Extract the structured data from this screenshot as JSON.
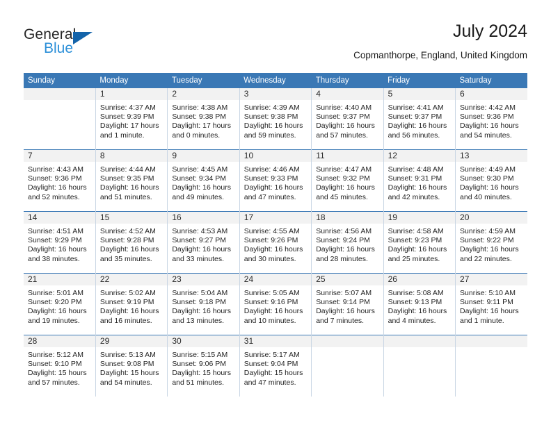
{
  "brand": {
    "name_top": "General",
    "name_bottom": "Blue",
    "triangle_color": "#1464aa",
    "blue_color": "#2b8fd8"
  },
  "header": {
    "title": "July 2024",
    "subtitle": "Copmanthorpe, England, United Kingdom"
  },
  "theme": {
    "header_bg": "#3a78b5",
    "daynum_bg": "#f2f2f2",
    "grid_line": "#c9d6e4",
    "week_line": "#3a78b5"
  },
  "weekday_headers": [
    "Sunday",
    "Monday",
    "Tuesday",
    "Wednesday",
    "Thursday",
    "Friday",
    "Saturday"
  ],
  "weeks": [
    [
      {
        "day": "",
        "sunrise": "",
        "sunset": "",
        "daylight_1": "",
        "daylight_2": ""
      },
      {
        "day": "1",
        "sunrise": "Sunrise: 4:37 AM",
        "sunset": "Sunset: 9:39 PM",
        "daylight_1": "Daylight: 17 hours",
        "daylight_2": "and 1 minute."
      },
      {
        "day": "2",
        "sunrise": "Sunrise: 4:38 AM",
        "sunset": "Sunset: 9:38 PM",
        "daylight_1": "Daylight: 17 hours",
        "daylight_2": "and 0 minutes."
      },
      {
        "day": "3",
        "sunrise": "Sunrise: 4:39 AM",
        "sunset": "Sunset: 9:38 PM",
        "daylight_1": "Daylight: 16 hours",
        "daylight_2": "and 59 minutes."
      },
      {
        "day": "4",
        "sunrise": "Sunrise: 4:40 AM",
        "sunset": "Sunset: 9:37 PM",
        "daylight_1": "Daylight: 16 hours",
        "daylight_2": "and 57 minutes."
      },
      {
        "day": "5",
        "sunrise": "Sunrise: 4:41 AM",
        "sunset": "Sunset: 9:37 PM",
        "daylight_1": "Daylight: 16 hours",
        "daylight_2": "and 56 minutes."
      },
      {
        "day": "6",
        "sunrise": "Sunrise: 4:42 AM",
        "sunset": "Sunset: 9:36 PM",
        "daylight_1": "Daylight: 16 hours",
        "daylight_2": "and 54 minutes."
      }
    ],
    [
      {
        "day": "7",
        "sunrise": "Sunrise: 4:43 AM",
        "sunset": "Sunset: 9:36 PM",
        "daylight_1": "Daylight: 16 hours",
        "daylight_2": "and 52 minutes."
      },
      {
        "day": "8",
        "sunrise": "Sunrise: 4:44 AM",
        "sunset": "Sunset: 9:35 PM",
        "daylight_1": "Daylight: 16 hours",
        "daylight_2": "and 51 minutes."
      },
      {
        "day": "9",
        "sunrise": "Sunrise: 4:45 AM",
        "sunset": "Sunset: 9:34 PM",
        "daylight_1": "Daylight: 16 hours",
        "daylight_2": "and 49 minutes."
      },
      {
        "day": "10",
        "sunrise": "Sunrise: 4:46 AM",
        "sunset": "Sunset: 9:33 PM",
        "daylight_1": "Daylight: 16 hours",
        "daylight_2": "and 47 minutes."
      },
      {
        "day": "11",
        "sunrise": "Sunrise: 4:47 AM",
        "sunset": "Sunset: 9:32 PM",
        "daylight_1": "Daylight: 16 hours",
        "daylight_2": "and 45 minutes."
      },
      {
        "day": "12",
        "sunrise": "Sunrise: 4:48 AM",
        "sunset": "Sunset: 9:31 PM",
        "daylight_1": "Daylight: 16 hours",
        "daylight_2": "and 42 minutes."
      },
      {
        "day": "13",
        "sunrise": "Sunrise: 4:49 AM",
        "sunset": "Sunset: 9:30 PM",
        "daylight_1": "Daylight: 16 hours",
        "daylight_2": "and 40 minutes."
      }
    ],
    [
      {
        "day": "14",
        "sunrise": "Sunrise: 4:51 AM",
        "sunset": "Sunset: 9:29 PM",
        "daylight_1": "Daylight: 16 hours",
        "daylight_2": "and 38 minutes."
      },
      {
        "day": "15",
        "sunrise": "Sunrise: 4:52 AM",
        "sunset": "Sunset: 9:28 PM",
        "daylight_1": "Daylight: 16 hours",
        "daylight_2": "and 35 minutes."
      },
      {
        "day": "16",
        "sunrise": "Sunrise: 4:53 AM",
        "sunset": "Sunset: 9:27 PM",
        "daylight_1": "Daylight: 16 hours",
        "daylight_2": "and 33 minutes."
      },
      {
        "day": "17",
        "sunrise": "Sunrise: 4:55 AM",
        "sunset": "Sunset: 9:26 PM",
        "daylight_1": "Daylight: 16 hours",
        "daylight_2": "and 30 minutes."
      },
      {
        "day": "18",
        "sunrise": "Sunrise: 4:56 AM",
        "sunset": "Sunset: 9:24 PM",
        "daylight_1": "Daylight: 16 hours",
        "daylight_2": "and 28 minutes."
      },
      {
        "day": "19",
        "sunrise": "Sunrise: 4:58 AM",
        "sunset": "Sunset: 9:23 PM",
        "daylight_1": "Daylight: 16 hours",
        "daylight_2": "and 25 minutes."
      },
      {
        "day": "20",
        "sunrise": "Sunrise: 4:59 AM",
        "sunset": "Sunset: 9:22 PM",
        "daylight_1": "Daylight: 16 hours",
        "daylight_2": "and 22 minutes."
      }
    ],
    [
      {
        "day": "21",
        "sunrise": "Sunrise: 5:01 AM",
        "sunset": "Sunset: 9:20 PM",
        "daylight_1": "Daylight: 16 hours",
        "daylight_2": "and 19 minutes."
      },
      {
        "day": "22",
        "sunrise": "Sunrise: 5:02 AM",
        "sunset": "Sunset: 9:19 PM",
        "daylight_1": "Daylight: 16 hours",
        "daylight_2": "and 16 minutes."
      },
      {
        "day": "23",
        "sunrise": "Sunrise: 5:04 AM",
        "sunset": "Sunset: 9:18 PM",
        "daylight_1": "Daylight: 16 hours",
        "daylight_2": "and 13 minutes."
      },
      {
        "day": "24",
        "sunrise": "Sunrise: 5:05 AM",
        "sunset": "Sunset: 9:16 PM",
        "daylight_1": "Daylight: 16 hours",
        "daylight_2": "and 10 minutes."
      },
      {
        "day": "25",
        "sunrise": "Sunrise: 5:07 AM",
        "sunset": "Sunset: 9:14 PM",
        "daylight_1": "Daylight: 16 hours",
        "daylight_2": "and 7 minutes."
      },
      {
        "day": "26",
        "sunrise": "Sunrise: 5:08 AM",
        "sunset": "Sunset: 9:13 PM",
        "daylight_1": "Daylight: 16 hours",
        "daylight_2": "and 4 minutes."
      },
      {
        "day": "27",
        "sunrise": "Sunrise: 5:10 AM",
        "sunset": "Sunset: 9:11 PM",
        "daylight_1": "Daylight: 16 hours",
        "daylight_2": "and 1 minute."
      }
    ],
    [
      {
        "day": "28",
        "sunrise": "Sunrise: 5:12 AM",
        "sunset": "Sunset: 9:10 PM",
        "daylight_1": "Daylight: 15 hours",
        "daylight_2": "and 57 minutes."
      },
      {
        "day": "29",
        "sunrise": "Sunrise: 5:13 AM",
        "sunset": "Sunset: 9:08 PM",
        "daylight_1": "Daylight: 15 hours",
        "daylight_2": "and 54 minutes."
      },
      {
        "day": "30",
        "sunrise": "Sunrise: 5:15 AM",
        "sunset": "Sunset: 9:06 PM",
        "daylight_1": "Daylight: 15 hours",
        "daylight_2": "and 51 minutes."
      },
      {
        "day": "31",
        "sunrise": "Sunrise: 5:17 AM",
        "sunset": "Sunset: 9:04 PM",
        "daylight_1": "Daylight: 15 hours",
        "daylight_2": "and 47 minutes."
      },
      {
        "day": "",
        "sunrise": "",
        "sunset": "",
        "daylight_1": "",
        "daylight_2": ""
      },
      {
        "day": "",
        "sunrise": "",
        "sunset": "",
        "daylight_1": "",
        "daylight_2": ""
      },
      {
        "day": "",
        "sunrise": "",
        "sunset": "",
        "daylight_1": "",
        "daylight_2": ""
      }
    ]
  ]
}
